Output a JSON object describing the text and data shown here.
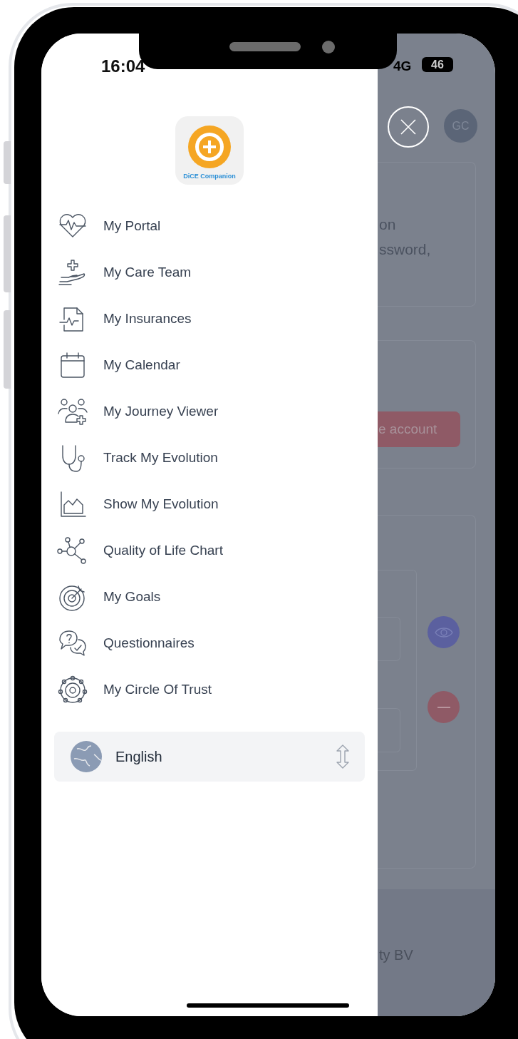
{
  "status_bar": {
    "time": "16:04",
    "network": "4G",
    "battery": "46"
  },
  "drawer": {
    "logo_caption": "DiCE Companion",
    "items": [
      {
        "label": "My Portal",
        "kind": "heartbeat"
      },
      {
        "label": "My Care Team",
        "kind": "hand"
      },
      {
        "label": "My Insurances",
        "kind": "document"
      },
      {
        "label": "My Calendar",
        "kind": "calendar"
      },
      {
        "label": "My Journey Viewer",
        "kind": "people"
      },
      {
        "label": "Track My Evolution",
        "kind": "stethoscope"
      },
      {
        "label": "Show My Evolution",
        "kind": "chart"
      },
      {
        "label": "Quality of Life Chart",
        "kind": "network"
      },
      {
        "label": "My Goals",
        "kind": "target"
      },
      {
        "label": "Questionnaires",
        "kind": "chat"
      },
      {
        "label": "My Circle Of Trust",
        "kind": "circle"
      }
    ],
    "language": {
      "label": "English"
    }
  },
  "background": {
    "avatar": "GC",
    "texts": [
      "on",
      "ssword,"
    ],
    "button": "e account",
    "footer": "ty BV"
  }
}
